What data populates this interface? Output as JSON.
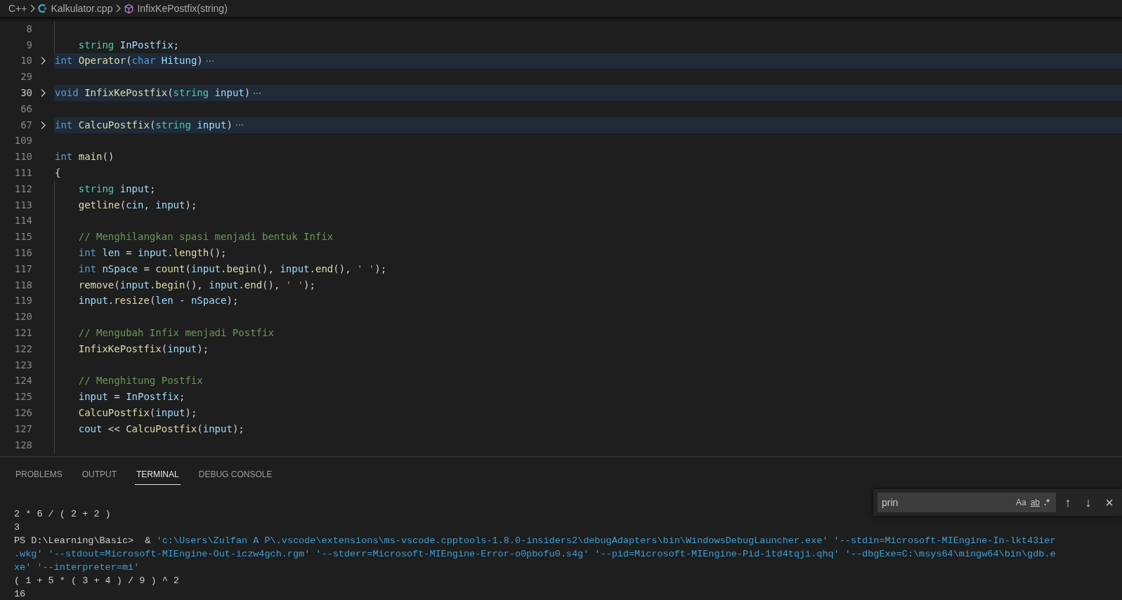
{
  "breadcrumb": [
    {
      "kind": "language",
      "text": "C++"
    },
    {
      "kind": "file",
      "text": "Kalkulator.cpp"
    },
    {
      "kind": "symbol",
      "text": "InfixKePostfix(string)"
    }
  ],
  "editor": {
    "lines": [
      {
        "number": "8",
        "folded": false,
        "current": false,
        "guide": true
      },
      {
        "number": "9",
        "folded": false,
        "current": false,
        "guide": true,
        "tokens": [
          {
            "text": "    string",
            "kind": "type"
          },
          {
            "text": " InPostfix",
            "kind": "variable"
          },
          {
            "text": ";",
            "kind": "plain"
          }
        ]
      },
      {
        "number": "10",
        "folded": true,
        "current": false,
        "guide": false,
        "tokens": [
          {
            "text": "int",
            "kind": "keyword"
          },
          {
            "text": " Operator",
            "kind": "function"
          },
          {
            "text": "(",
            "kind": "plain"
          },
          {
            "text": "char",
            "kind": "keyword"
          },
          {
            "text": " Hitung",
            "kind": "variable"
          },
          {
            "text": ")",
            "kind": "plain"
          }
        ]
      },
      {
        "number": "29",
        "current": false
      },
      {
        "number": "30",
        "folded": true,
        "current": true,
        "guide": false,
        "tokens": [
          {
            "text": "void",
            "kind": "keyword"
          },
          {
            "text": " InfixKePostfix",
            "kind": "function"
          },
          {
            "text": "(",
            "kind": "plain"
          },
          {
            "text": "string",
            "kind": "type"
          },
          {
            "text": " input",
            "kind": "variable"
          },
          {
            "text": ")",
            "kind": "plain"
          }
        ]
      },
      {
        "number": "66",
        "current": false
      },
      {
        "number": "67",
        "folded": true,
        "current": false,
        "guide": false,
        "tokens": [
          {
            "text": "int",
            "kind": "keyword"
          },
          {
            "text": " CalcuPostfix",
            "kind": "function"
          },
          {
            "text": "(",
            "kind": "plain"
          },
          {
            "text": "string",
            "kind": "type"
          },
          {
            "text": " input",
            "kind": "variable"
          },
          {
            "text": ")",
            "kind": "plain"
          }
        ]
      },
      {
        "number": "109",
        "current": false
      },
      {
        "number": "110",
        "folded": false,
        "current": false,
        "guide": false,
        "tokens": [
          {
            "text": "int",
            "kind": "keyword"
          },
          {
            "text": " main",
            "kind": "function"
          },
          {
            "text": "()",
            "kind": "plain"
          }
        ]
      },
      {
        "number": "111",
        "folded": false,
        "current": false,
        "guide": false,
        "tokens": [
          {
            "text": "{",
            "kind": "plain"
          }
        ]
      },
      {
        "number": "112",
        "folded": false,
        "current": false,
        "guide": true,
        "tokens": [
          {
            "text": "    string",
            "kind": "type"
          },
          {
            "text": " input",
            "kind": "variable"
          },
          {
            "text": ";",
            "kind": "plain"
          }
        ]
      },
      {
        "number": "113",
        "folded": false,
        "current": false,
        "guide": true,
        "tokens": [
          {
            "text": "    getline",
            "kind": "function"
          },
          {
            "text": "(",
            "kind": "plain"
          },
          {
            "text": "cin",
            "kind": "variable"
          },
          {
            "text": ", ",
            "kind": "plain"
          },
          {
            "text": "input",
            "kind": "variable"
          },
          {
            "text": ");",
            "kind": "plain"
          }
        ]
      },
      {
        "number": "114",
        "folded": false,
        "current": false,
        "guide": true
      },
      {
        "number": "115",
        "folded": false,
        "current": false,
        "guide": true,
        "tokens": [
          {
            "text": "    // Menghilangkan spasi menjadi bentuk Infix",
            "kind": "comment"
          }
        ]
      },
      {
        "number": "116",
        "folded": false,
        "current": false,
        "guide": true,
        "tokens": [
          {
            "text": "    int",
            "kind": "keyword"
          },
          {
            "text": " len",
            "kind": "variable"
          },
          {
            "text": " = ",
            "kind": "plain"
          },
          {
            "text": "input",
            "kind": "variable"
          },
          {
            "text": ".",
            "kind": "plain"
          },
          {
            "text": "length",
            "kind": "function"
          },
          {
            "text": "();",
            "kind": "plain"
          }
        ]
      },
      {
        "number": "117",
        "folded": false,
        "current": false,
        "guide": true,
        "tokens": [
          {
            "text": "    int",
            "kind": "keyword"
          },
          {
            "text": " nSpace",
            "kind": "variable"
          },
          {
            "text": " = ",
            "kind": "plain"
          },
          {
            "text": "count",
            "kind": "function"
          },
          {
            "text": "(",
            "kind": "plain"
          },
          {
            "text": "input",
            "kind": "variable"
          },
          {
            "text": ".",
            "kind": "plain"
          },
          {
            "text": "begin",
            "kind": "function"
          },
          {
            "text": "(), ",
            "kind": "plain"
          },
          {
            "text": "input",
            "kind": "variable"
          },
          {
            "text": ".",
            "kind": "plain"
          },
          {
            "text": "end",
            "kind": "function"
          },
          {
            "text": "(), ",
            "kind": "plain"
          },
          {
            "text": "' '",
            "kind": "string"
          },
          {
            "text": ");",
            "kind": "plain"
          }
        ]
      },
      {
        "number": "118",
        "folded": false,
        "current": false,
        "guide": true,
        "tokens": [
          {
            "text": "    remove",
            "kind": "function"
          },
          {
            "text": "(",
            "kind": "plain"
          },
          {
            "text": "input",
            "kind": "variable"
          },
          {
            "text": ".",
            "kind": "plain"
          },
          {
            "text": "begin",
            "kind": "function"
          },
          {
            "text": "(), ",
            "kind": "plain"
          },
          {
            "text": "input",
            "kind": "variable"
          },
          {
            "text": ".",
            "kind": "plain"
          },
          {
            "text": "end",
            "kind": "function"
          },
          {
            "text": "(), ",
            "kind": "plain"
          },
          {
            "text": "' '",
            "kind": "string"
          },
          {
            "text": ");",
            "kind": "plain"
          }
        ]
      },
      {
        "number": "119",
        "folded": false,
        "current": false,
        "guide": true,
        "tokens": [
          {
            "text": "    input",
            "kind": "variable"
          },
          {
            "text": ".",
            "kind": "plain"
          },
          {
            "text": "resize",
            "kind": "function"
          },
          {
            "text": "(",
            "kind": "plain"
          },
          {
            "text": "len",
            "kind": "variable"
          },
          {
            "text": " - ",
            "kind": "plain"
          },
          {
            "text": "nSpace",
            "kind": "variable"
          },
          {
            "text": ");",
            "kind": "plain"
          }
        ]
      },
      {
        "number": "120",
        "folded": false,
        "current": false,
        "guide": true
      },
      {
        "number": "121",
        "folded": false,
        "current": false,
        "guide": true,
        "tokens": [
          {
            "text": "    // Mengubah Infix menjadi Postfix",
            "kind": "comment"
          }
        ]
      },
      {
        "number": "122",
        "folded": false,
        "current": false,
        "guide": true,
        "tokens": [
          {
            "text": "    InfixKePostfix",
            "kind": "function"
          },
          {
            "text": "(",
            "kind": "plain"
          },
          {
            "text": "input",
            "kind": "variable"
          },
          {
            "text": ");",
            "kind": "plain"
          }
        ]
      },
      {
        "number": "123",
        "folded": false,
        "current": false,
        "guide": true
      },
      {
        "number": "124",
        "folded": false,
        "current": false,
        "guide": true,
        "tokens": [
          {
            "text": "    // Menghitung Postfix",
            "kind": "comment"
          }
        ]
      },
      {
        "number": "125",
        "folded": false,
        "current": false,
        "guide": true,
        "tokens": [
          {
            "text": "    input",
            "kind": "variable"
          },
          {
            "text": " = ",
            "kind": "plain"
          },
          {
            "text": "InPostfix",
            "kind": "variable"
          },
          {
            "text": ";",
            "kind": "plain"
          }
        ]
      },
      {
        "number": "126",
        "folded": false,
        "current": false,
        "guide": true,
        "tokens": [
          {
            "text": "    CalcuPostfix",
            "kind": "function"
          },
          {
            "text": "(",
            "kind": "plain"
          },
          {
            "text": "input",
            "kind": "variable"
          },
          {
            "text": ");",
            "kind": "plain"
          }
        ]
      },
      {
        "number": "127",
        "folded": false,
        "current": false,
        "guide": true,
        "tokens": [
          {
            "text": "    cout",
            "kind": "variable"
          },
          {
            "text": " << ",
            "kind": "plain"
          },
          {
            "text": "CalcuPostfix",
            "kind": "function"
          },
          {
            "text": "(",
            "kind": "plain"
          },
          {
            "text": "input",
            "kind": "variable"
          },
          {
            "text": ");",
            "kind": "plain"
          }
        ]
      },
      {
        "number": "128",
        "folded": false,
        "current": false,
        "guide": true
      }
    ]
  },
  "panel": {
    "tabs": [
      {
        "label": "PROBLEMS",
        "selected": false
      },
      {
        "label": "OUTPUT",
        "selected": false
      },
      {
        "label": "TERMINAL",
        "selected": true
      },
      {
        "label": "DEBUG CONSOLE",
        "selected": false
      }
    ],
    "terminal": {
      "lines": [
        {
          "segments": [
            {
              "text": "2 * 6 / ( 2 + 2 )",
              "kind": "plain"
            }
          ]
        },
        {
          "segments": [
            {
              "text": "3",
              "kind": "plain"
            }
          ]
        },
        {
          "segments": [
            {
              "text": "PS D:\\Learning\\Basic>  & ",
              "kind": "plain"
            },
            {
              "text": "'c:\\Users\\Zulfan A P\\.vscode\\extensions\\ms-vscode.cpptools-1.8.0-insiders2\\debugAdapters\\bin\\WindowsDebugLauncher.exe' '--stdin=Microsoft-MIEngine-In-lkt43ier",
              "kind": "string"
            }
          ]
        },
        {
          "segments": [
            {
              "text": ".wkg' '--stdout=Microsoft-MIEngine-Out-iczw4gch.rgm' '--stderr=Microsoft-MIEngine-Error-o0pbofu0.s4g' '--pid=Microsoft-MIEngine-Pid-1td4tqji.qhq' '--dbgExe=C:\\msys64\\mingw64\\bin\\gdb.e",
              "kind": "string"
            }
          ]
        },
        {
          "segments": [
            {
              "text": "xe' '--interpreter=mi'",
              "kind": "string"
            }
          ]
        },
        {
          "segments": [
            {
              "text": "( 1 + 5 * ( 3 + 4 ) / 9 ) ^ 2",
              "kind": "plain"
            }
          ]
        },
        {
          "segments": [
            {
              "text": "16",
              "kind": "plain"
            }
          ]
        }
      ]
    },
    "find": {
      "value": "prin",
      "toggles": [
        {
          "kind": "case",
          "label": "Aa"
        },
        {
          "kind": "word",
          "label": "ab"
        },
        {
          "kind": "regex",
          "label": ".*"
        }
      ],
      "buttons": [
        {
          "kind": "previous",
          "label": "↑"
        },
        {
          "kind": "next",
          "label": "↓"
        },
        {
          "kind": "close",
          "label": "×"
        }
      ]
    }
  }
}
